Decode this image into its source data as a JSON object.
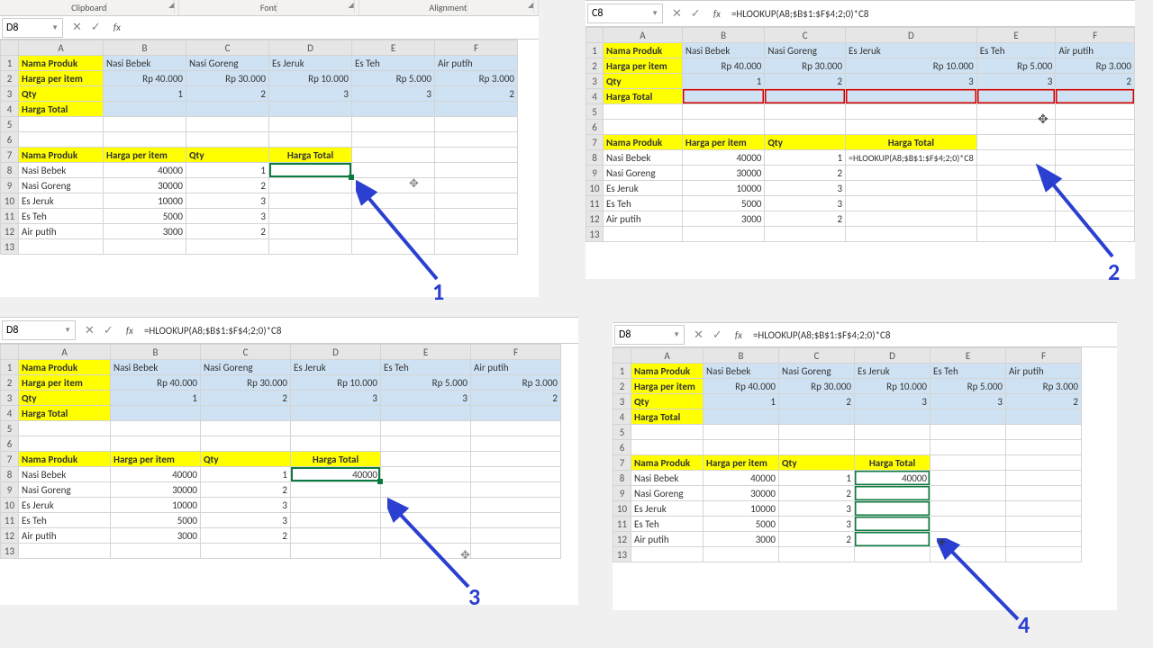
{
  "ribbon": {
    "g1": "Clipboard",
    "g2": "Font",
    "g3": "Alignment"
  },
  "p1": {
    "namebox": "D8",
    "formula": "",
    "cols": [
      "",
      "A",
      "B",
      "C",
      "D",
      "E",
      "F"
    ],
    "r1": [
      "1",
      "Nama Produk",
      "Nasi Bebek",
      "Nasi Goreng",
      "Es Jeruk",
      "Es Teh",
      "Air putih"
    ],
    "r2": [
      "2",
      "Harga per item",
      "Rp      40.000",
      "Rp      30.000",
      "Rp      10.000",
      "Rp        5.000",
      "Rp        3.000"
    ],
    "r3": [
      "3",
      "Qty",
      "1",
      "2",
      "3",
      "3",
      "2"
    ],
    "r4": [
      "4",
      "Harga Total",
      "",
      "",
      "",
      "",
      ""
    ],
    "r7": [
      "7",
      "Nama Produk",
      "Harga per item",
      "Qty",
      "Harga Total"
    ],
    "r8": [
      "8",
      "Nasi Bebek",
      "40000",
      "1",
      ""
    ],
    "r9": [
      "9",
      "Nasi Goreng",
      "30000",
      "2",
      ""
    ],
    "r10": [
      "10",
      "Es Jeruk",
      "10000",
      "3",
      ""
    ],
    "r11": [
      "11",
      "Es Teh",
      "5000",
      "3",
      ""
    ],
    "r12": [
      "12",
      "Air putih",
      "3000",
      "2",
      ""
    ]
  },
  "p2": {
    "namebox": "C8",
    "formula": "=HLOOKUP(A8;$B$1:$F$4;2;0)*C8",
    "cols": [
      "",
      "A",
      "B",
      "C",
      "D",
      "E",
      "F"
    ],
    "r1": [
      "1",
      "Nama Produk",
      "Nasi Bebek",
      "Nasi Goreng",
      "Es Jeruk",
      "Es Teh",
      "Air putih"
    ],
    "r2": [
      "2",
      "Harga per item",
      "Rp      40.000",
      "Rp      30.000",
      "Rp      10.000",
      "Rp        5.000",
      "Rp        3.000"
    ],
    "r3": [
      "3",
      "Qty",
      "1",
      "2",
      "3",
      "3",
      "2"
    ],
    "r4": [
      "4",
      "Harga Total",
      "",
      "",
      "",
      "",
      ""
    ],
    "r7": [
      "7",
      "Nama Produk",
      "Harga per item",
      "Qty",
      "Harga Total"
    ],
    "r8": [
      "8",
      "Nasi Bebek",
      "40000",
      "1",
      "=HLOOKUP(A8;$B$1:$F$4;2;0)*C8"
    ],
    "r9": [
      "9",
      "Nasi Goreng",
      "30000",
      "2",
      ""
    ],
    "r10": [
      "10",
      "Es Jeruk",
      "10000",
      "3",
      ""
    ],
    "r11": [
      "11",
      "Es Teh",
      "5000",
      "3",
      ""
    ],
    "r12": [
      "12",
      "Air putih",
      "3000",
      "2",
      ""
    ]
  },
  "p3": {
    "namebox": "D8",
    "formula": "=HLOOKUP(A8;$B$1:$F$4;2;0)*C8",
    "cols": [
      "",
      "A",
      "B",
      "C",
      "D",
      "E",
      "F"
    ],
    "r1": [
      "1",
      "Nama Produk",
      "Nasi Bebek",
      "Nasi Goreng",
      "Es Jeruk",
      "Es Teh",
      "Air putih"
    ],
    "r2": [
      "2",
      "Harga per item",
      "Rp      40.000",
      "Rp      30.000",
      "Rp      10.000",
      "Rp        5.000",
      "Rp        3.000"
    ],
    "r3": [
      "3",
      "Qty",
      "1",
      "2",
      "3",
      "3",
      "2"
    ],
    "r4": [
      "4",
      "Harga Total",
      "",
      "",
      "",
      "",
      ""
    ],
    "r7": [
      "7",
      "Nama Produk",
      "Harga per item",
      "Qty",
      "Harga Total"
    ],
    "r8": [
      "8",
      "Nasi Bebek",
      "40000",
      "1",
      "40000"
    ],
    "r9": [
      "9",
      "Nasi Goreng",
      "30000",
      "2",
      ""
    ],
    "r10": [
      "10",
      "Es Jeruk",
      "10000",
      "3",
      ""
    ],
    "r11": [
      "11",
      "Es Teh",
      "5000",
      "3",
      ""
    ],
    "r12": [
      "12",
      "Air putih",
      "3000",
      "2",
      ""
    ]
  },
  "p4": {
    "namebox": "D8",
    "formula": "=HLOOKUP(A8;$B$1:$F$4;2;0)*C8",
    "cols": [
      "",
      "A",
      "B",
      "C",
      "D",
      "E",
      "F"
    ],
    "r1": [
      "1",
      "Nama Produk",
      "Nasi Bebek",
      "Nasi Goreng",
      "Es Jeruk",
      "Es Teh",
      "Air putih"
    ],
    "r2": [
      "2",
      "Harga per item",
      "Rp      40.000",
      "Rp      30.000",
      "Rp      10.000",
      "Rp        5.000",
      "Rp        3.000"
    ],
    "r3": [
      "3",
      "Qty",
      "1",
      "2",
      "3",
      "3",
      "2"
    ],
    "r4": [
      "4",
      "Harga Total",
      "",
      "",
      "",
      "",
      ""
    ],
    "r7": [
      "7",
      "Nama Produk",
      "Harga per item",
      "Qty",
      "Harga Total"
    ],
    "r8": [
      "8",
      "Nasi Bebek",
      "40000",
      "1",
      "40000"
    ],
    "r9": [
      "9",
      "Nasi Goreng",
      "30000",
      "2",
      ""
    ],
    "r10": [
      "10",
      "Es Jeruk",
      "10000",
      "3",
      ""
    ],
    "r11": [
      "11",
      "Es Teh",
      "5000",
      "3",
      ""
    ],
    "r12": [
      "12",
      "Air putih",
      "3000",
      "2",
      ""
    ]
  },
  "steps": {
    "s1": "1",
    "s2": "2",
    "s3": "3",
    "s4": "4"
  },
  "icons": {
    "cross": "✕",
    "check": "✓",
    "fx": "fx",
    "dd": "▼"
  },
  "colwidths": {
    "p1": [
      20,
      94,
      92,
      92,
      92,
      92,
      92
    ],
    "p2": [
      20,
      90,
      94,
      94,
      94,
      94,
      94
    ],
    "p3": [
      20,
      102,
      100,
      100,
      100,
      100,
      100
    ],
    "p4": [
      20,
      80,
      84,
      84,
      84,
      84,
      84
    ]
  }
}
